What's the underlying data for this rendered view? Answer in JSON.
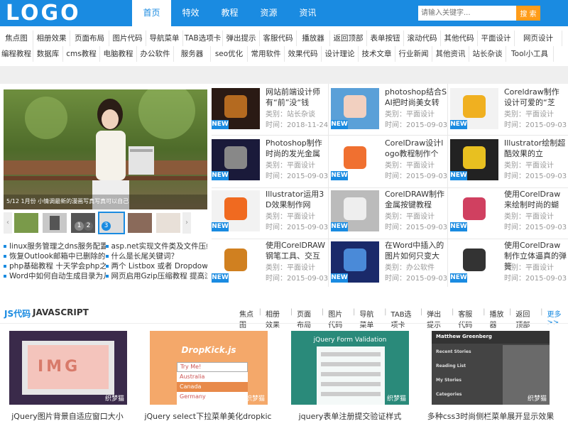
{
  "logo": "LOGO",
  "nav": [
    "首页",
    "特效",
    "教程",
    "资源",
    "资讯"
  ],
  "search": {
    "placeholder": "请输入关键字...",
    "button": "搜 索"
  },
  "tags_row1": [
    "焦点图",
    "相册效果",
    "页面布局",
    "图片代码",
    "导航菜单",
    "TAB选项卡",
    "弹出提示",
    "客服代码",
    "播放器",
    "返回顶部",
    "表单按钮",
    "滚动代码",
    "其他代码",
    "平面设计",
    "网页设计"
  ],
  "tags_row2": [
    "编程教程",
    "数据库",
    "cms教程",
    "电脑教程",
    "办公软件",
    "服务器",
    "seo优化",
    "常用软件",
    "效果代码",
    "设计理论",
    "技术文章",
    "行业新闻",
    "其他资讯",
    "站长杂谈",
    "Tool小工具"
  ],
  "slider": {
    "thumb_numbers": [
      "1",
      "2",
      "3"
    ]
  },
  "links": [
    [
      "linux服务管理之dns服务配置教",
      "asp.net实现文件类及文件压缩"
    ],
    [
      "恢复Outlook邮箱中已删除的邮",
      "什么是长尾关键词？"
    ],
    [
      "php基础教程 十天学会php之第",
      "两个 Listbox 或者 DropdownLi"
    ],
    [
      "Word中如何自动生成目录为几十",
      "网页启用Gzip压缩教程 提高浏"
    ]
  ],
  "cards": [
    {
      "title": "网站前端设计师有“前”没“钱",
      "cat": "类别：站长杂谈",
      "time": "时间：2018-11-24"
    },
    {
      "title": "photoshop结合SAI把时尚美女转",
      "cat": "类别：平面设计",
      "time": "时间：2015-09-03"
    },
    {
      "title": "Coreldraw制作设计可爱的“芝",
      "cat": "类别：平面设计",
      "time": "时间：2015-09-03"
    },
    {
      "title": "Photoshop制作时尚的发光金属",
      "cat": "类别：平面设计",
      "time": "时间：2015-09-03"
    },
    {
      "title": "CorelDraw设计logo教程制作个",
      "cat": "类别：平面设计",
      "time": "时间：2015-09-03"
    },
    {
      "title": "Illustrator绘制超酷效果的立",
      "cat": "类别：平面设计",
      "time": "时间：2015-09-03"
    },
    {
      "title": "Illustrator运用3D效果制作网",
      "cat": "类别：平面设计",
      "time": "时间：2015-09-03"
    },
    {
      "title": "CorelDRAW制作金属按键教程",
      "cat": "类别：平面设计",
      "time": "时间：2015-09-03"
    },
    {
      "title": "使用CorelDraw来绘制时尚的蝴",
      "cat": "类别：平面设计",
      "time": "时间：2015-09-03"
    },
    {
      "title": "使用CorelDRAW钢笔工具、交互",
      "cat": "类别：平面设计",
      "time": "时间：2015-09-03"
    },
    {
      "title": "在Word中插入的图片如何只变大",
      "cat": "类别：办公软件",
      "time": "时间：2015-09-03"
    },
    {
      "title": "使用CorelDraw制作立体逼真的弹簧",
      "cat": "类别：平面设计",
      "time": "时间：2015-09-03"
    }
  ],
  "new_badge": "NEW",
  "js": {
    "title_cn": "JS代码",
    "title_en": "JAVASCRIPT",
    "links": [
      "焦点图",
      "相册效果",
      "页面布局",
      "图片代码",
      "导航菜单",
      "TAB选项卡",
      "弹出提示",
      "客服代码",
      "播放器",
      "返回顶部"
    ],
    "more": "更多>>"
  },
  "demos": [
    {
      "caption": "jQuery图片背景自适应窗口大小",
      "text": "IMG",
      "mark": "织梦猫"
    },
    {
      "caption": "jQuery select下拉菜单美化dropkic",
      "text": "DropKick.js",
      "options": [
        "Try Me!",
        "Australia",
        "Canada",
        "Germany"
      ],
      "mark": "织梦猫"
    },
    {
      "caption": "jquery表单注册提交验证样式",
      "text": "jQuery Form Validation",
      "mark": "织梦猫"
    },
    {
      "caption": "多种css3时尚侧栏菜单展开显示效果",
      "text": "Matthew Greenberg",
      "menu": [
        "Recent Stories",
        "Reading List",
        "My Stories",
        "Categories"
      ],
      "mark": "织梦猫"
    }
  ],
  "image_overlay": "5/12  1月份 小情调最新的漫画写真写真可以自己"
}
